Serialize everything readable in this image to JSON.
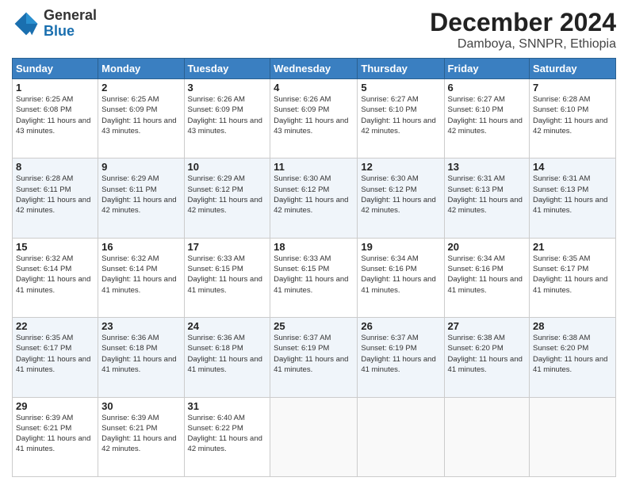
{
  "header": {
    "logo": {
      "line1": "General",
      "line2": "Blue"
    },
    "title": "December 2024",
    "location": "Damboya, SNNPR, Ethiopia"
  },
  "weekdays": [
    "Sunday",
    "Monday",
    "Tuesday",
    "Wednesday",
    "Thursday",
    "Friday",
    "Saturday"
  ],
  "weeks": [
    [
      {
        "day": "1",
        "sunrise": "6:25 AM",
        "sunset": "6:08 PM",
        "daylight": "11 hours and 43 minutes."
      },
      {
        "day": "2",
        "sunrise": "6:25 AM",
        "sunset": "6:09 PM",
        "daylight": "11 hours and 43 minutes."
      },
      {
        "day": "3",
        "sunrise": "6:26 AM",
        "sunset": "6:09 PM",
        "daylight": "11 hours and 43 minutes."
      },
      {
        "day": "4",
        "sunrise": "6:26 AM",
        "sunset": "6:09 PM",
        "daylight": "11 hours and 43 minutes."
      },
      {
        "day": "5",
        "sunrise": "6:27 AM",
        "sunset": "6:10 PM",
        "daylight": "11 hours and 42 minutes."
      },
      {
        "day": "6",
        "sunrise": "6:27 AM",
        "sunset": "6:10 PM",
        "daylight": "11 hours and 42 minutes."
      },
      {
        "day": "7",
        "sunrise": "6:28 AM",
        "sunset": "6:10 PM",
        "daylight": "11 hours and 42 minutes."
      }
    ],
    [
      {
        "day": "8",
        "sunrise": "6:28 AM",
        "sunset": "6:11 PM",
        "daylight": "11 hours and 42 minutes."
      },
      {
        "day": "9",
        "sunrise": "6:29 AM",
        "sunset": "6:11 PM",
        "daylight": "11 hours and 42 minutes."
      },
      {
        "day": "10",
        "sunrise": "6:29 AM",
        "sunset": "6:12 PM",
        "daylight": "11 hours and 42 minutes."
      },
      {
        "day": "11",
        "sunrise": "6:30 AM",
        "sunset": "6:12 PM",
        "daylight": "11 hours and 42 minutes."
      },
      {
        "day": "12",
        "sunrise": "6:30 AM",
        "sunset": "6:12 PM",
        "daylight": "11 hours and 42 minutes."
      },
      {
        "day": "13",
        "sunrise": "6:31 AM",
        "sunset": "6:13 PM",
        "daylight": "11 hours and 42 minutes."
      },
      {
        "day": "14",
        "sunrise": "6:31 AM",
        "sunset": "6:13 PM",
        "daylight": "11 hours and 41 minutes."
      }
    ],
    [
      {
        "day": "15",
        "sunrise": "6:32 AM",
        "sunset": "6:14 PM",
        "daylight": "11 hours and 41 minutes."
      },
      {
        "day": "16",
        "sunrise": "6:32 AM",
        "sunset": "6:14 PM",
        "daylight": "11 hours and 41 minutes."
      },
      {
        "day": "17",
        "sunrise": "6:33 AM",
        "sunset": "6:15 PM",
        "daylight": "11 hours and 41 minutes."
      },
      {
        "day": "18",
        "sunrise": "6:33 AM",
        "sunset": "6:15 PM",
        "daylight": "11 hours and 41 minutes."
      },
      {
        "day": "19",
        "sunrise": "6:34 AM",
        "sunset": "6:16 PM",
        "daylight": "11 hours and 41 minutes."
      },
      {
        "day": "20",
        "sunrise": "6:34 AM",
        "sunset": "6:16 PM",
        "daylight": "11 hours and 41 minutes."
      },
      {
        "day": "21",
        "sunrise": "6:35 AM",
        "sunset": "6:17 PM",
        "daylight": "11 hours and 41 minutes."
      }
    ],
    [
      {
        "day": "22",
        "sunrise": "6:35 AM",
        "sunset": "6:17 PM",
        "daylight": "11 hours and 41 minutes."
      },
      {
        "day": "23",
        "sunrise": "6:36 AM",
        "sunset": "6:18 PM",
        "daylight": "11 hours and 41 minutes."
      },
      {
        "day": "24",
        "sunrise": "6:36 AM",
        "sunset": "6:18 PM",
        "daylight": "11 hours and 41 minutes."
      },
      {
        "day": "25",
        "sunrise": "6:37 AM",
        "sunset": "6:19 PM",
        "daylight": "11 hours and 41 minutes."
      },
      {
        "day": "26",
        "sunrise": "6:37 AM",
        "sunset": "6:19 PM",
        "daylight": "11 hours and 41 minutes."
      },
      {
        "day": "27",
        "sunrise": "6:38 AM",
        "sunset": "6:20 PM",
        "daylight": "11 hours and 41 minutes."
      },
      {
        "day": "28",
        "sunrise": "6:38 AM",
        "sunset": "6:20 PM",
        "daylight": "11 hours and 41 minutes."
      }
    ],
    [
      {
        "day": "29",
        "sunrise": "6:39 AM",
        "sunset": "6:21 PM",
        "daylight": "11 hours and 41 minutes."
      },
      {
        "day": "30",
        "sunrise": "6:39 AM",
        "sunset": "6:21 PM",
        "daylight": "11 hours and 42 minutes."
      },
      {
        "day": "31",
        "sunrise": "6:40 AM",
        "sunset": "6:22 PM",
        "daylight": "11 hours and 42 minutes."
      },
      null,
      null,
      null,
      null
    ]
  ],
  "labels": {
    "sunrise": "Sunrise:",
    "sunset": "Sunset:",
    "daylight": "Daylight:"
  }
}
